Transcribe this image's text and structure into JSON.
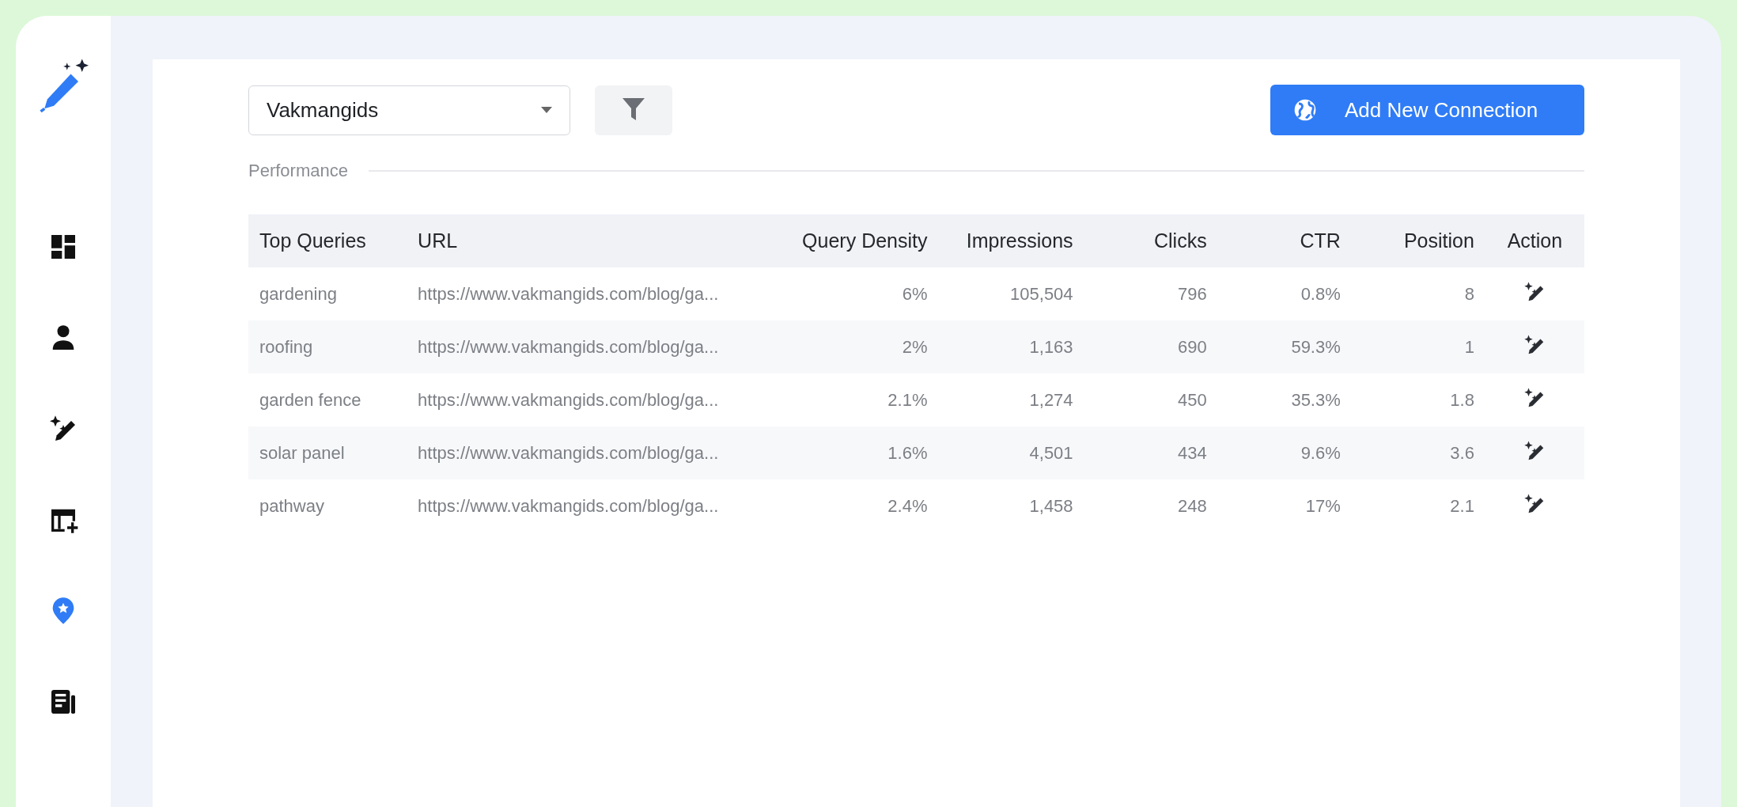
{
  "sidebar": {
    "items": [
      {
        "kind": "dashboard",
        "selected": false
      },
      {
        "kind": "user",
        "selected": false
      },
      {
        "kind": "magic",
        "selected": false
      },
      {
        "kind": "calendar",
        "selected": false
      },
      {
        "kind": "pin",
        "selected": true
      },
      {
        "kind": "news",
        "selected": false
      }
    ]
  },
  "toolbar": {
    "site_select": {
      "value": "Vakmangids"
    },
    "add_button": "Add New Connection"
  },
  "section_title": "Performance",
  "table": {
    "columns": [
      "Top Queries",
      "URL",
      "Query Density",
      "Impressions",
      "Clicks",
      "CTR",
      "Position",
      "Action"
    ],
    "rows": [
      [
        "gardening",
        "https://www.vakmangids.com/blog/ga...",
        "6%",
        "105,504",
        "796",
        "0.8%",
        "8"
      ],
      [
        "roofing",
        "https://www.vakmangids.com/blog/ga...",
        "2%",
        "1,163",
        "690",
        "59.3%",
        "1"
      ],
      [
        "garden fence",
        "https://www.vakmangids.com/blog/ga...",
        "2.1%",
        "1,274",
        "450",
        "35.3%",
        "1.8"
      ],
      [
        "solar panel",
        "https://www.vakmangids.com/blog/ga...",
        "1.6%",
        "4,501",
        "434",
        "9.6%",
        "3.6"
      ],
      [
        "pathway",
        "https://www.vakmangids.com/blog/ga...",
        "2.4%",
        "1,458",
        "248",
        "17%",
        "2.1"
      ]
    ]
  }
}
